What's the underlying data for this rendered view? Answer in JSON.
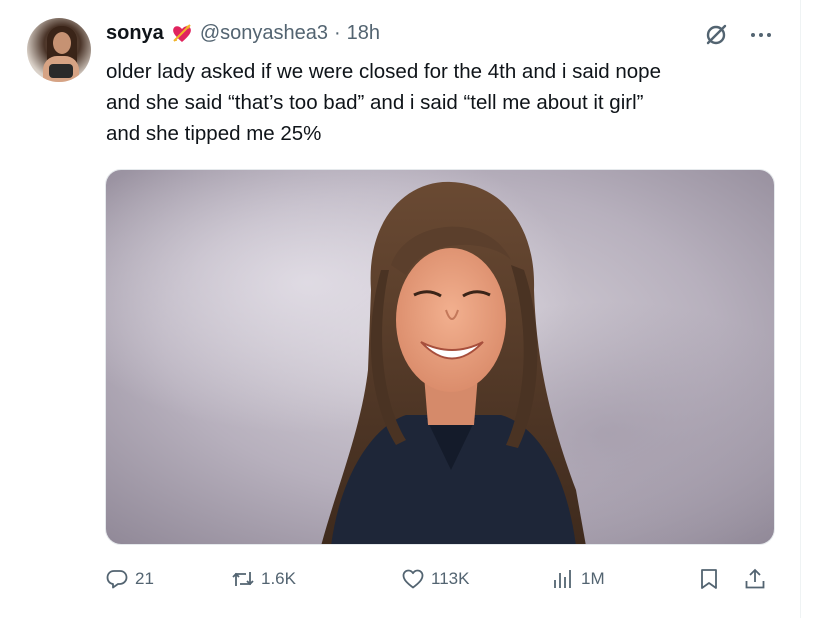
{
  "tweet": {
    "author": {
      "display_name": "sonya",
      "badge_icon": "heart-with-arrow-icon",
      "handle": "@sonyashea3",
      "separator": "·",
      "time": "18h"
    },
    "text_lines": [
      "older lady asked if we were closed for the 4th and i said nope",
      "and she said “that’s too bad” and i said “tell me about it girl”",
      "and she tipped me 25%"
    ],
    "media": {
      "type": "photo",
      "icon": "photo"
    },
    "actions": {
      "reply": {
        "icon": "reply-icon",
        "count": "21"
      },
      "retweet": {
        "icon": "retweet-icon",
        "count": "1.6K"
      },
      "like": {
        "icon": "heart-icon",
        "count": "113K"
      },
      "views": {
        "icon": "views-icon",
        "count": "1M"
      },
      "bookmark": {
        "icon": "bookmark-icon"
      },
      "share": {
        "icon": "share-icon"
      }
    },
    "top_icons": [
      "grok-icon",
      "more-icon"
    ]
  },
  "colors": {
    "text": "#0f1419",
    "secondary": "#536471",
    "background": "#ffffff"
  }
}
